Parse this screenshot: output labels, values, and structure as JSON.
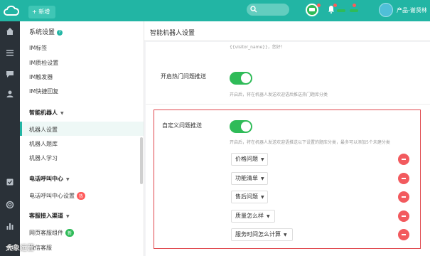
{
  "topbar": {
    "new_label": "+ 新增",
    "user_name": "产品-谢贤林"
  },
  "sidebar": {
    "title": "系统设置",
    "help": "?",
    "im_items": [
      "IM标签",
      "IM质检设置",
      "IM触发器",
      "IM快捷回复"
    ],
    "groups": [
      {
        "label": "智能机器人",
        "items": [
          "机器人设置",
          "机器人题库",
          "机器人学习"
        ]
      },
      {
        "label": "电话呼叫中心",
        "items": [
          "电话呼叫中心设置"
        ],
        "badge": "热"
      },
      {
        "label": "客服接入渠道",
        "items": [
          "网页客服组件",
          "微信客服"
        ],
        "badge": "新"
      }
    ]
  },
  "main": {
    "title": "智能机器人设置",
    "greeting_hint": "{{visitor_name}}，您好！",
    "hot_push": {
      "label": "开启热门问题推送",
      "enabled": true,
      "hint": "开启后，将在机器人发送欢迎语后推送热门题库分类"
    },
    "custom_push": {
      "label": "自定义问题推送",
      "enabled": true,
      "hint": "开启后，将在机器人发送欢迎语推送以下设置的题库分类，最多可以添加5个未建分类",
      "categories": [
        "价格问题",
        "功能清单",
        "售后问题",
        "质量怎么样",
        "服务时间怎么计算"
      ]
    }
  },
  "watermark": "大象运营",
  "colors": {
    "brand": "#22b5a4",
    "toggle_on": "#2fbb58",
    "danger": "#f25a5e",
    "highlight_border": "#e0454b"
  }
}
